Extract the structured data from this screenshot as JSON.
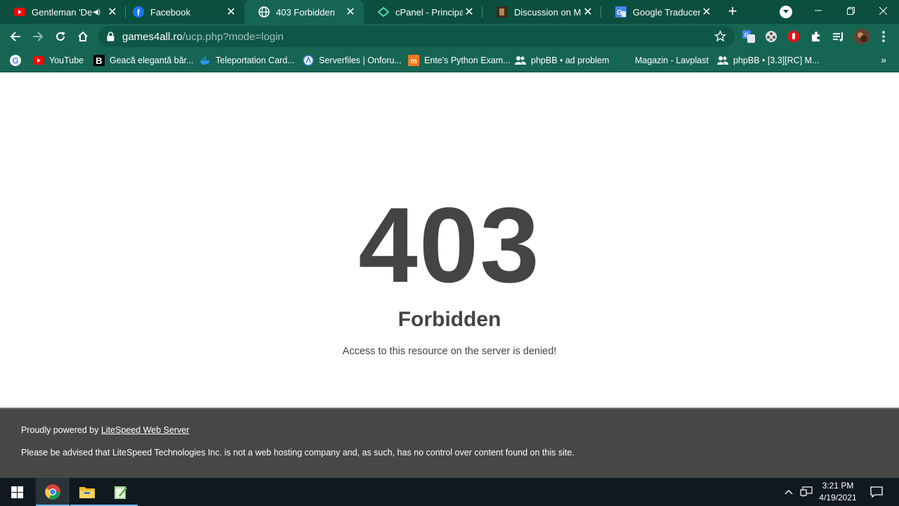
{
  "browser": {
    "tabs": [
      {
        "title": "Gentleman 'De",
        "favicon": "youtube-icon",
        "extra_icon": "audio-icon"
      },
      {
        "title": "Facebook",
        "favicon": "facebook-icon"
      },
      {
        "title": "403 Forbidden",
        "favicon": "globe-icon",
        "active": true
      },
      {
        "title": "cPanel - Principal",
        "favicon": "cpanel-icon"
      },
      {
        "title": "Discussion on Milk",
        "favicon": "forum-icon"
      },
      {
        "title": "Google Traducere",
        "favicon": "translate-icon"
      }
    ],
    "url_host": "games4all.ro",
    "url_path": "/ucp.php?mode=login",
    "bookmarks": [
      {
        "label": "",
        "icon": "google-icon"
      },
      {
        "label": "YouTube",
        "icon": "youtube-icon"
      },
      {
        "label": "Geacă elegantă băr...",
        "icon": "b-brand-icon"
      },
      {
        "label": "Teleportation Card...",
        "icon": "docker-icon"
      },
      {
        "label": "Serverfiles | Onforu...",
        "icon": "serverfiles-icon"
      },
      {
        "label": "Ente's Python Exam...",
        "icon": "mi-icon"
      },
      {
        "label": "phpBB • ad problem",
        "icon": "users-icon"
      },
      {
        "label": "Magazin - Lavplast",
        "icon": ""
      },
      {
        "label": "phpBB • [3.3][RC] M...",
        "icon": "users-icon"
      }
    ],
    "bookmarks_more": "»"
  },
  "page": {
    "code": "403",
    "heading": "Forbidden",
    "message": "Access to this resource on the server is denied!",
    "footer": {
      "powered_prefix": "Proudly powered by ",
      "powered_link": "LiteSpeed Web Server",
      "notice": "Please be advised that LiteSpeed Technologies Inc. is not a web hosting company and, as such, has no control over content found on this site."
    }
  },
  "taskbar": {
    "apps": [
      "chrome-icon",
      "file-explorer-icon",
      "notepad-icon"
    ],
    "time": "3:21 PM",
    "date": "4/19/2021"
  },
  "colors": {
    "tab_strip": "#0b4f3f",
    "toolbar": "#166553",
    "text_dark": "#444444",
    "footer_bg": "#474747",
    "taskbar": "#101820"
  }
}
